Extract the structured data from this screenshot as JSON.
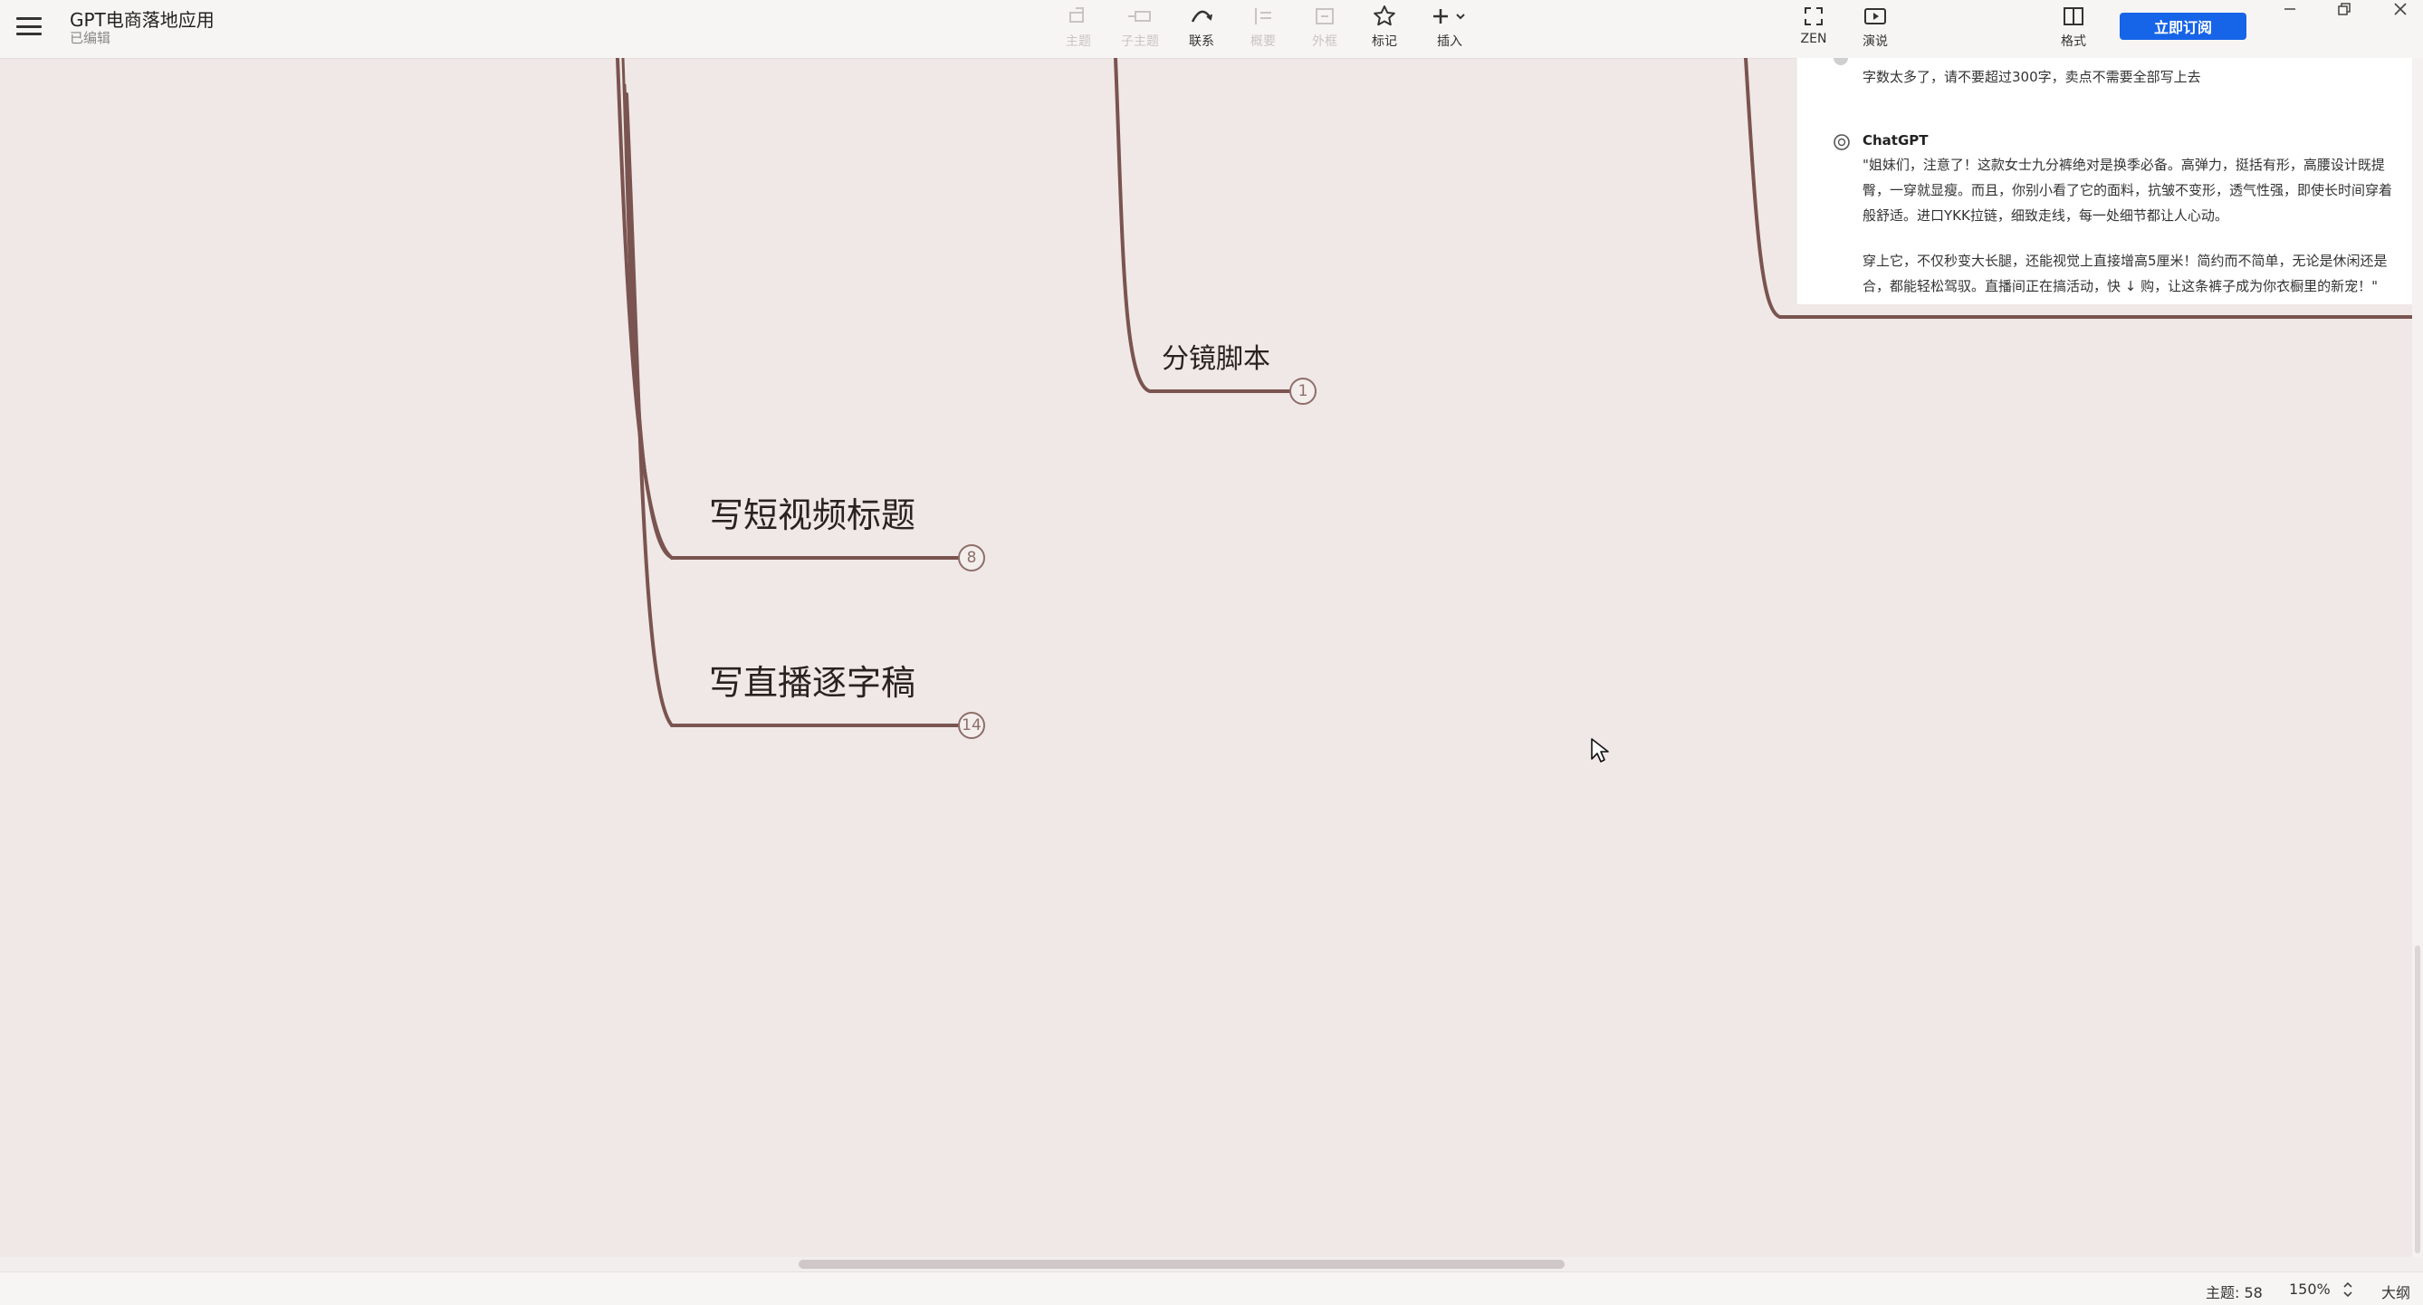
{
  "app": {
    "title": "GPT电商落地应用",
    "subtitle": "已编辑"
  },
  "toolbar": {
    "tools": [
      {
        "label": "主题",
        "icon": "topic-icon",
        "enabled": false
      },
      {
        "label": "子主题",
        "icon": "subtopic-icon",
        "enabled": false
      },
      {
        "label": "联系",
        "icon": "relationship-icon",
        "enabled": true
      },
      {
        "label": "概要",
        "icon": "summary-icon",
        "enabled": false
      },
      {
        "label": "外框",
        "icon": "boundary-icon",
        "enabled": false
      },
      {
        "label": "标记",
        "icon": "star-icon",
        "enabled": true
      },
      {
        "label": "插入",
        "icon": "plus-icon",
        "enabled": true
      }
    ],
    "zen_label": "ZEN",
    "present_label": "演说",
    "format_label": "格式",
    "subscribe_label": "立即订阅"
  },
  "mindmap": {
    "topics": [
      {
        "text": "分镜脚本",
        "count": "1"
      },
      {
        "text": "写短视频标题",
        "count": "8"
      },
      {
        "text": "写直播逐字稿",
        "count": "14"
      }
    ]
  },
  "chat": {
    "previous_message": "字数太多了，请不要超过300字，卖点不需要全部写上去",
    "assistant_name": "ChatGPT",
    "paragraph1": [
      "\"姐妹们，注意了！这款女士九分裤绝对是换季必备。高弹力，挺括有形，高腰设计既提",
      "臀，一穿就显瘦。而且，你别小看了它的面料，抗皱不变形，透气性强，即使长时间穿着",
      "般舒适。进口YKK拉链，细致走线，每一处细节都让人心动。"
    ],
    "paragraph2": [
      "穿上它，不仅秒变大长腿，还能视觉上直接增高5厘米！简约而不简单，无论是休闲还是",
      "合，都能轻松驾驭。直播间正在搞活动，快 ↓ 购，让这条裤子成为你衣橱里的新宠！\""
    ]
  },
  "status": {
    "topic_count": "主题: 58",
    "zoom": "150%",
    "outline_label": "大纲"
  }
}
